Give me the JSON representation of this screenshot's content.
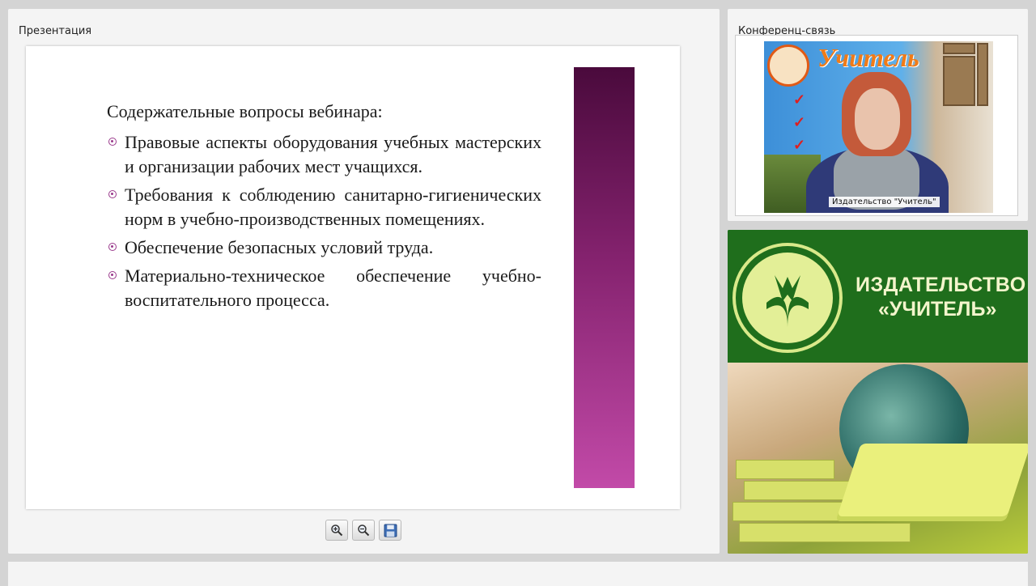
{
  "presentation": {
    "panel_title": "Презентация",
    "slide": {
      "heading": "Содержательные вопросы вебинара:",
      "items": [
        "Правовые аспекты оборудования учебных мастерских и организации рабочих мест учащихся.",
        "Требования к соблюдению санитарно-гигиенических норм в учебно-производственных помещениях.",
        "Обеспечение безопасных условий труда.",
        "Материально-техническое обеспечение учебно-воспитательного процесса."
      ],
      "accent_color": "#84226e"
    },
    "toolbar": {
      "zoom_in_icon": "zoom-in-icon",
      "zoom_out_icon": "zoom-out-icon",
      "save_icon": "save-icon"
    }
  },
  "conference": {
    "panel_title": "Конференц-связь",
    "video_caption": "Издательство \"Учитель\"",
    "banner": {
      "brand": "Учитель"
    }
  },
  "ad": {
    "line1": "ИЗДАТЕЛЬСТВО",
    "line2": "«УЧИТЕЛЬ»",
    "brand_color": "#1f6e1c"
  }
}
